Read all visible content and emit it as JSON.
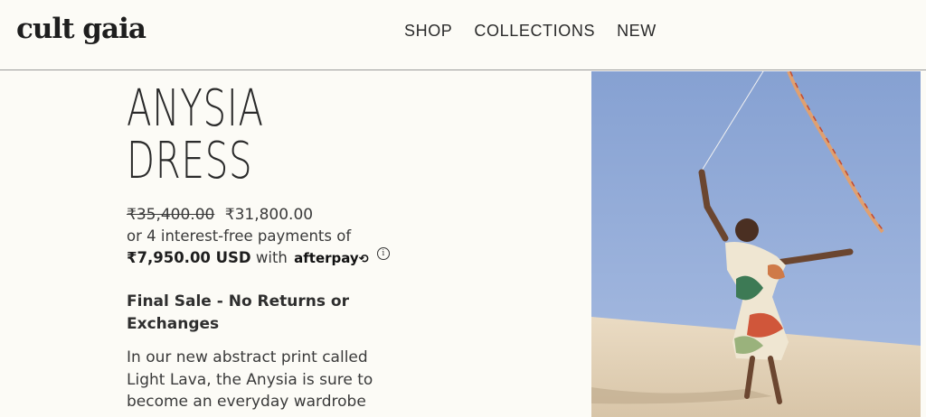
{
  "header": {
    "logo": "cult gaia",
    "nav": [
      {
        "label": "SHOP"
      },
      {
        "label": "COLLECTIONS"
      },
      {
        "label": "NEW"
      }
    ]
  },
  "product": {
    "title_line1": "ANYSIA",
    "title_line2": "DRESS",
    "original_price": "₹35,400.00",
    "sale_price": "₹31,800.00",
    "installments_text": "or 4 interest-free payments of",
    "installment_amount": "₹7,950.00 USD",
    "installment_with": "with",
    "afterpay_label": "afterpay",
    "info_glyph": "i",
    "final_sale": "Final Sale - No Returns or Exchanges",
    "description": "In our new abstract print called Light Lava, the Anysia is sure to become an everyday wardrobe"
  },
  "colors": {
    "background": "#fcfbf6",
    "sky": "#8fa7d3",
    "sand": "#e4d4bb"
  }
}
